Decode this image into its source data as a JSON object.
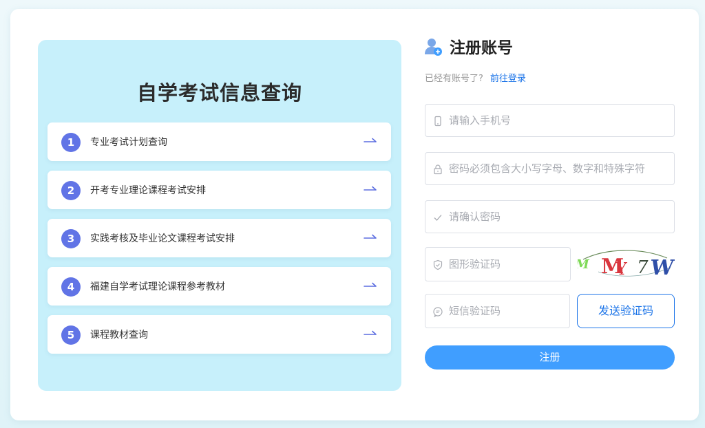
{
  "left": {
    "title": "自学考试信息查询",
    "items": [
      {
        "num": "1",
        "label": "专业考试计划查询"
      },
      {
        "num": "2",
        "label": "开考专业理论课程考试安排"
      },
      {
        "num": "3",
        "label": "实践考核及毕业论文课程考试安排"
      },
      {
        "num": "4",
        "label": "福建自学考试理论课程参考教材"
      },
      {
        "num": "5",
        "label": "课程教材查询"
      }
    ]
  },
  "register": {
    "title": "注册账号",
    "have_account": "已经有账号了?",
    "login_link": "前往登录",
    "phone_placeholder": "请输入手机号",
    "password_placeholder": "密码必须包含大小写字母、数字和特殊字符",
    "confirm_placeholder": "请确认密码",
    "captcha_placeholder": "图形验证码",
    "captcha_text": "MMY7W",
    "sms_placeholder": "短信验证码",
    "sms_button": "发送验证码",
    "submit": "注册"
  },
  "colors": {
    "accent": "#409eff",
    "link": "#1a73e8",
    "badge": "#6174e6",
    "panel": "#c7f0fb"
  }
}
